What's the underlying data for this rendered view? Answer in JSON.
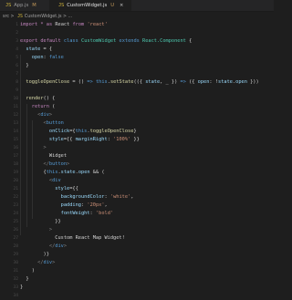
{
  "tabs": [
    {
      "icon": "JS",
      "label": "App.js",
      "status": "M",
      "active": false
    },
    {
      "icon": "JS",
      "label": "CustomWidget.js",
      "status": "U",
      "active": true
    }
  ],
  "tab_close_glyph": "×",
  "breadcrumb": {
    "folder": "src",
    "separator": " > ",
    "icon": "JS",
    "file": "CustomWidget.js",
    "tail": " > ..."
  },
  "code": [
    {
      "n": "1",
      "seg": [
        {
          "c": "k",
          "t": "import"
        },
        {
          "t": " "
        },
        {
          "c": "k",
          "t": "*"
        },
        {
          "t": " "
        },
        {
          "c": "k",
          "t": "as"
        },
        {
          "t": " React "
        },
        {
          "c": "k",
          "t": "from"
        },
        {
          "t": " "
        },
        {
          "c": "s",
          "t": "'react'"
        }
      ]
    },
    {
      "n": "2",
      "seg": []
    },
    {
      "n": "3",
      "seg": [
        {
          "c": "k",
          "t": "export default"
        },
        {
          "t": " "
        },
        {
          "c": "b",
          "t": "class"
        },
        {
          "t": " "
        },
        {
          "c": "t",
          "t": "CustomWidget"
        },
        {
          "t": " "
        },
        {
          "c": "b",
          "t": "extends"
        },
        {
          "t": " "
        },
        {
          "c": "t",
          "t": "React.Component"
        },
        {
          "t": " {"
        }
      ]
    },
    {
      "n": "4",
      "seg": [
        {
          "t": "  "
        },
        {
          "c": "v",
          "t": "state"
        },
        {
          "t": " = {"
        }
      ]
    },
    {
      "n": "5",
      "seg": [
        {
          "t": "    "
        },
        {
          "c": "v",
          "t": "open"
        },
        {
          "t": ": "
        },
        {
          "c": "b",
          "t": "false"
        }
      ]
    },
    {
      "n": "6",
      "seg": [
        {
          "t": "  }"
        }
      ]
    },
    {
      "n": "7",
      "seg": []
    },
    {
      "n": "8",
      "seg": [
        {
          "t": "  "
        },
        {
          "c": "f",
          "t": "toggleOpenClose"
        },
        {
          "t": " = () "
        },
        {
          "c": "b",
          "t": "=>"
        },
        {
          "t": " "
        },
        {
          "c": "b",
          "t": "this"
        },
        {
          "t": "."
        },
        {
          "c": "f",
          "t": "setState"
        },
        {
          "t": "(({ "
        },
        {
          "c": "v",
          "t": "state"
        },
        {
          "t": ", _ }) "
        },
        {
          "c": "b",
          "t": "=>"
        },
        {
          "t": " ({ "
        },
        {
          "c": "v",
          "t": "open"
        },
        {
          "t": ": !"
        },
        {
          "c": "v",
          "t": "state"
        },
        {
          "t": "."
        },
        {
          "c": "v",
          "t": "open"
        },
        {
          "t": " }))"
        }
      ]
    },
    {
      "n": "9",
      "seg": []
    },
    {
      "n": "10",
      "seg": [
        {
          "t": "  "
        },
        {
          "c": "f",
          "t": "render"
        },
        {
          "t": "() {"
        }
      ]
    },
    {
      "n": "11",
      "seg": [
        {
          "t": "    "
        },
        {
          "c": "k",
          "t": "return"
        },
        {
          "t": " ("
        }
      ]
    },
    {
      "n": "12",
      "seg": [
        {
          "t": "      "
        },
        {
          "c": "c",
          "t": "<"
        },
        {
          "c": "tg",
          "t": "div"
        },
        {
          "c": "c",
          "t": ">"
        }
      ]
    },
    {
      "n": "13",
      "seg": [
        {
          "t": "        "
        },
        {
          "c": "c",
          "t": "<"
        },
        {
          "c": "tg",
          "t": "button"
        }
      ]
    },
    {
      "n": "14",
      "seg": [
        {
          "t": "          "
        },
        {
          "c": "v",
          "t": "onClick"
        },
        {
          "t": "={"
        },
        {
          "c": "b",
          "t": "this"
        },
        {
          "t": "."
        },
        {
          "c": "f",
          "t": "toggleOpenClose"
        },
        {
          "t": "}"
        }
      ]
    },
    {
      "n": "15",
      "seg": [
        {
          "t": "          "
        },
        {
          "c": "v",
          "t": "style"
        },
        {
          "t": "={{ "
        },
        {
          "c": "v",
          "t": "marginRight"
        },
        {
          "t": ": "
        },
        {
          "c": "s",
          "t": "'100%'"
        },
        {
          "t": " }}"
        }
      ]
    },
    {
      "n": "16",
      "seg": [
        {
          "t": "        "
        },
        {
          "c": "c",
          "t": ">"
        }
      ]
    },
    {
      "n": "17",
      "seg": [
        {
          "t": "          Widget"
        }
      ]
    },
    {
      "n": "18",
      "seg": [
        {
          "t": "        "
        },
        {
          "c": "c",
          "t": "</"
        },
        {
          "c": "tg",
          "t": "button"
        },
        {
          "c": "c",
          "t": ">"
        }
      ]
    },
    {
      "n": "19",
      "seg": [
        {
          "t": "        {"
        },
        {
          "c": "b",
          "t": "this"
        },
        {
          "t": "."
        },
        {
          "c": "v",
          "t": "state"
        },
        {
          "t": "."
        },
        {
          "c": "v",
          "t": "open"
        },
        {
          "t": " && ("
        }
      ]
    },
    {
      "n": "20",
      "seg": [
        {
          "t": "          "
        },
        {
          "c": "c",
          "t": "<"
        },
        {
          "c": "tg",
          "t": "div"
        }
      ]
    },
    {
      "n": "21",
      "seg": [
        {
          "t": "            "
        },
        {
          "c": "v",
          "t": "style"
        },
        {
          "t": "={{"
        }
      ]
    },
    {
      "n": "22",
      "seg": [
        {
          "t": "              "
        },
        {
          "c": "v",
          "t": "backgroundColor"
        },
        {
          "t": ": "
        },
        {
          "c": "s",
          "t": "'white'"
        },
        {
          "t": ","
        }
      ]
    },
    {
      "n": "23",
      "seg": [
        {
          "t": "              "
        },
        {
          "c": "v",
          "t": "padding"
        },
        {
          "t": ": "
        },
        {
          "c": "s",
          "t": "'20px'"
        },
        {
          "t": ","
        }
      ]
    },
    {
      "n": "24",
      "seg": [
        {
          "t": "              "
        },
        {
          "c": "v",
          "t": "fontWeight"
        },
        {
          "t": ": "
        },
        {
          "c": "s",
          "t": "'bold'"
        }
      ]
    },
    {
      "n": "25",
      "seg": [
        {
          "t": "            }}"
        }
      ]
    },
    {
      "n": "26",
      "seg": [
        {
          "t": "          "
        },
        {
          "c": "c",
          "t": ">"
        }
      ]
    },
    {
      "n": "27",
      "seg": [
        {
          "t": "            Custom React Map Widget!"
        }
      ]
    },
    {
      "n": "28",
      "seg": [
        {
          "t": "          "
        },
        {
          "c": "c",
          "t": "</"
        },
        {
          "c": "tg",
          "t": "div"
        },
        {
          "c": "c",
          "t": ">"
        }
      ]
    },
    {
      "n": "29",
      "seg": [
        {
          "t": "        )}"
        }
      ]
    },
    {
      "n": "30",
      "seg": [
        {
          "t": "      "
        },
        {
          "c": "c",
          "t": "</"
        },
        {
          "c": "tg",
          "t": "div"
        },
        {
          "c": "c",
          "t": ">"
        }
      ]
    },
    {
      "n": "31",
      "seg": [
        {
          "t": "    )"
        }
      ]
    },
    {
      "n": "32",
      "seg": [
        {
          "t": "  }"
        }
      ]
    },
    {
      "n": "33",
      "seg": [
        {
          "t": "}"
        }
      ]
    },
    {
      "n": "34",
      "seg": []
    }
  ]
}
